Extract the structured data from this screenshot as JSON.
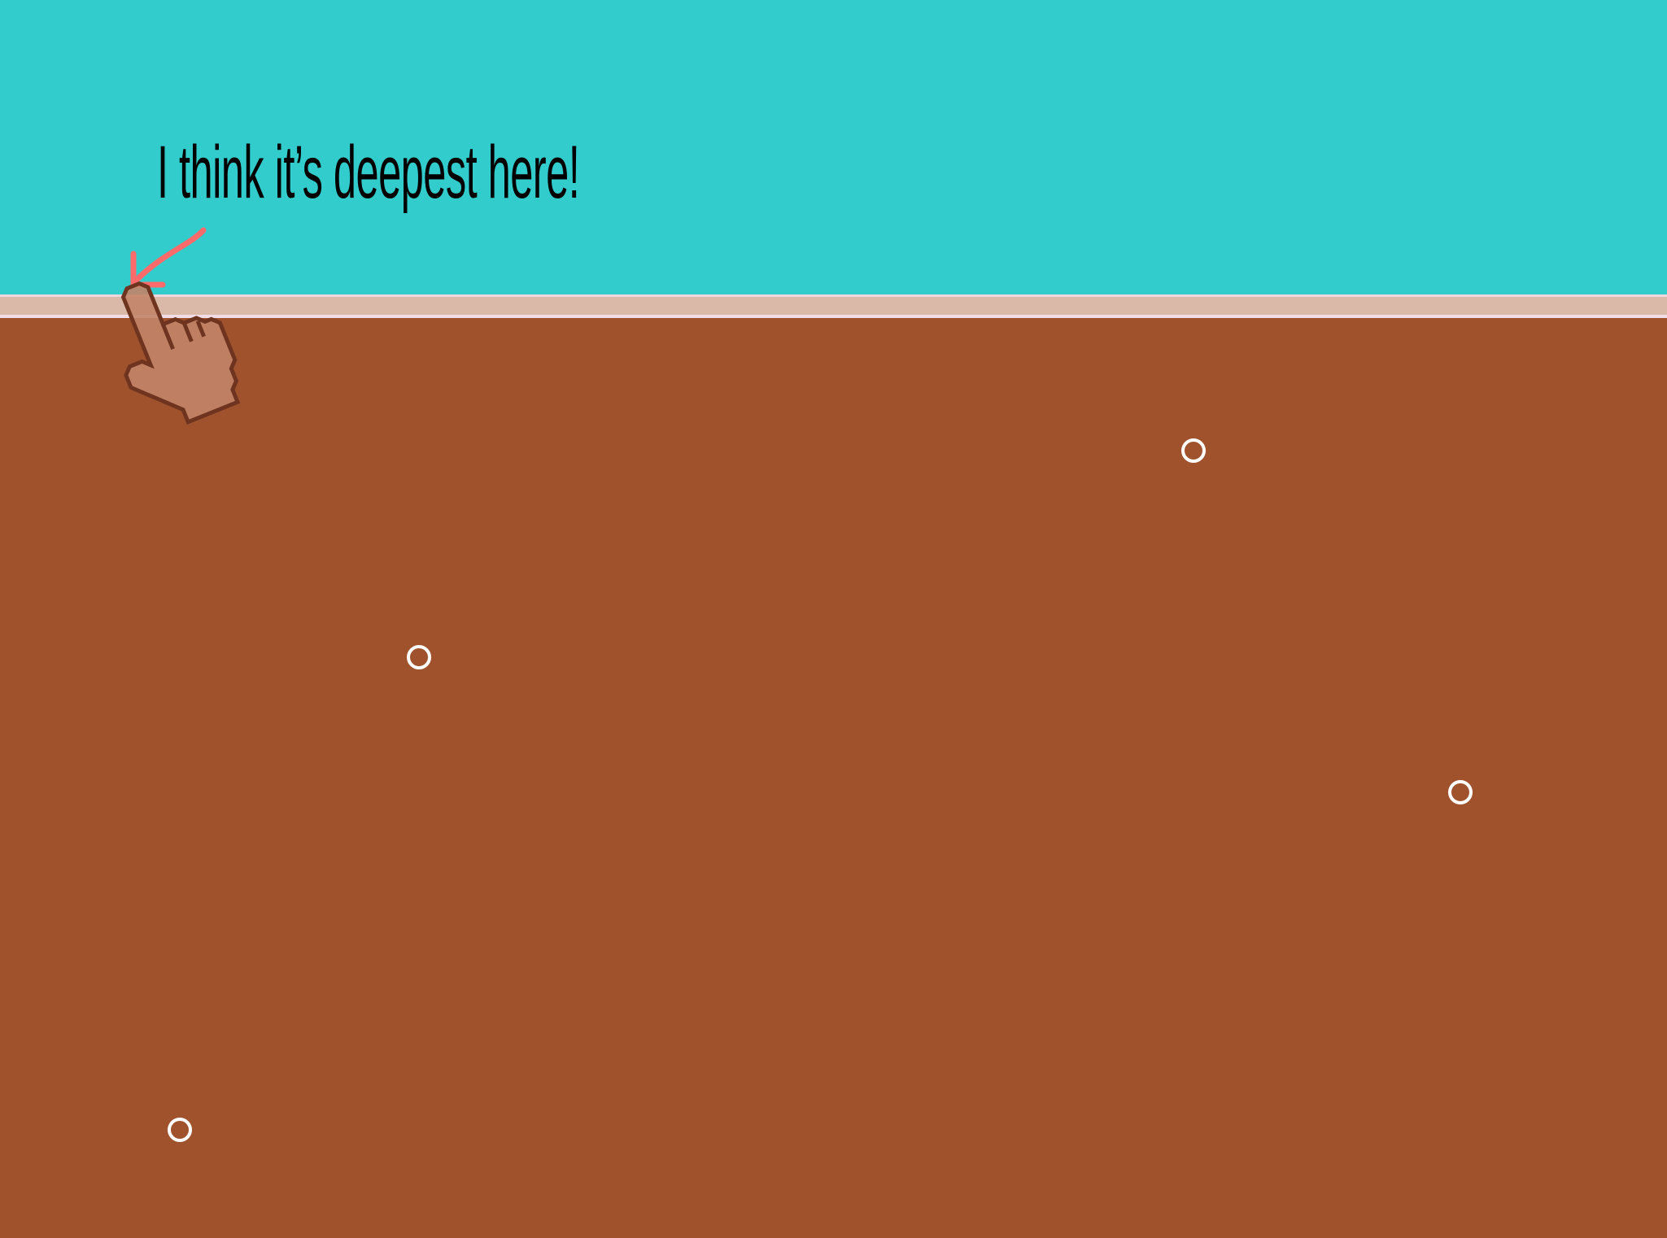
{
  "caption": "I think it’s deepest here!",
  "colors": {
    "water": "#33CCCC",
    "ground": "#A0522D",
    "surface": "#DAB9A8",
    "arrow": "#FF6B6B",
    "marker": "#FFFFFF"
  },
  "markers_count": 4,
  "icons": [
    "hand-pointer-cursor-icon",
    "arrow-down-left-icon",
    "circle-marker-icon"
  ]
}
